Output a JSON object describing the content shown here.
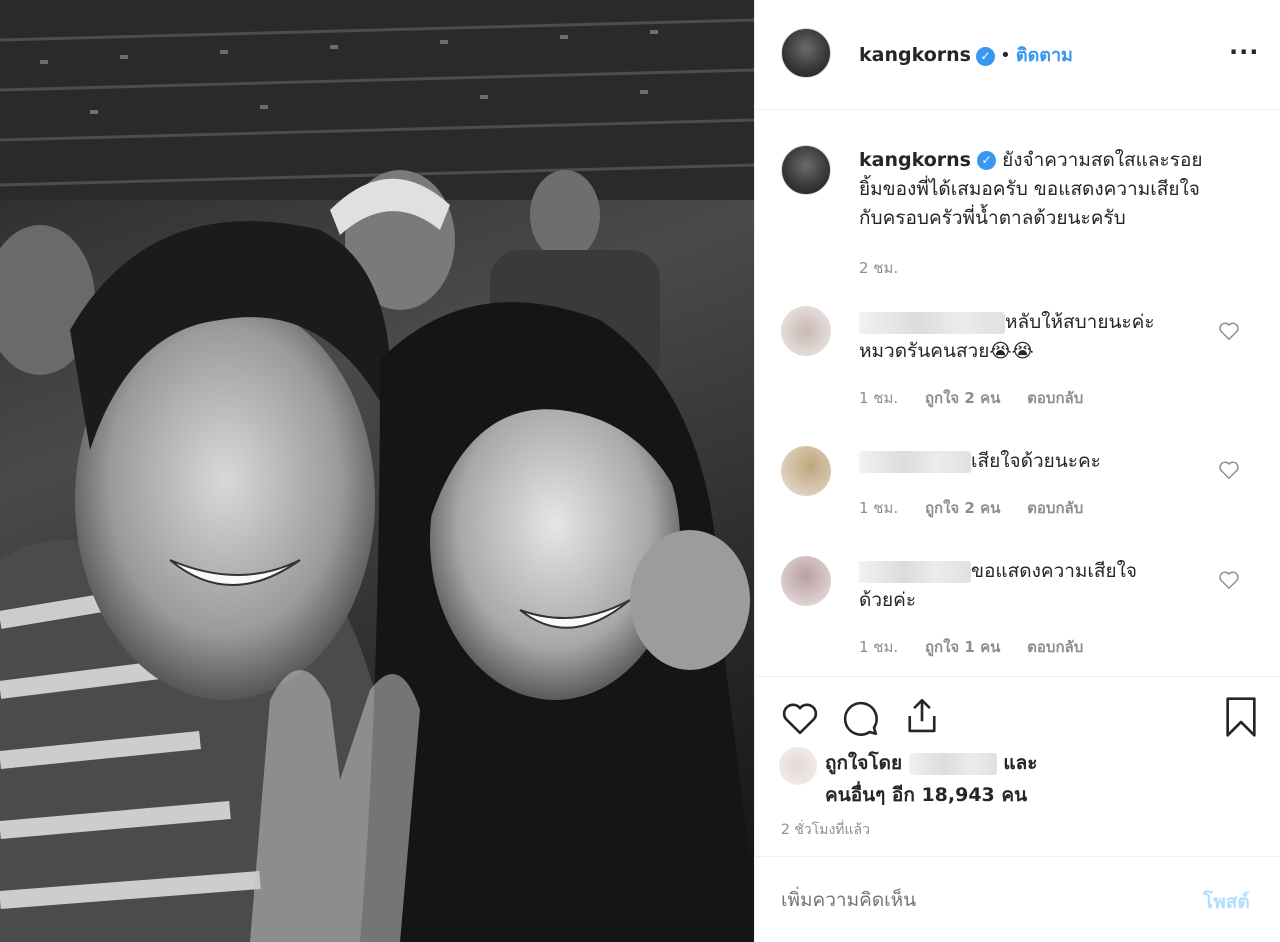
{
  "post": {
    "photo_alt_icon": "photo-icon"
  },
  "header": {
    "username": "kangkorns",
    "dot": "•",
    "follow_label": "ติดตาม",
    "more_label": "···"
  },
  "caption": {
    "username": "kangkorns",
    "text_line1": "ยังจำความสดใสและรอย",
    "text_line2": "ยิ้มของพี่ได้เสมอครับ ขอแสดงความเสียใจ",
    "text_line3": "กับครอบครัวพี่น้ำตาลด้วยนะครับ",
    "time": "2 ชม."
  },
  "comments": [
    {
      "text_line1": "หลับให้สบายนะค่ะ",
      "text_line2": "หมวดรันคนสวย😭😭",
      "time": "1 ชม.",
      "likes": "ถูกใจ 2 คน",
      "reply": "ตอบกลับ"
    },
    {
      "text_line1": "เสียใจด้วยนะคะ",
      "time": "1 ชม.",
      "likes": "ถูกใจ 2 คน",
      "reply": "ตอบกลับ"
    },
    {
      "text_line1": "ขอแสดงความเสียใจ",
      "text_line2": "ด้วยค่ะ",
      "time": "1 ชม.",
      "likes": "ถูกใจ 1 คน",
      "reply": "ตอบกลับ"
    }
  ],
  "likes": {
    "liked_by": "ถูกใจโดย",
    "and": "และ",
    "others": "คนอื่นๆ อีก 18,943 คน",
    "posted": "2 ชั่วโมงที่แล้ว"
  },
  "add_comment": {
    "placeholder": "เพิ่มความคิดเห็น",
    "post_label": "โพสต์"
  },
  "colors": {
    "accent": "#3897f0",
    "muted": "#8e8e8e",
    "post_disabled": "#b2dffc"
  }
}
